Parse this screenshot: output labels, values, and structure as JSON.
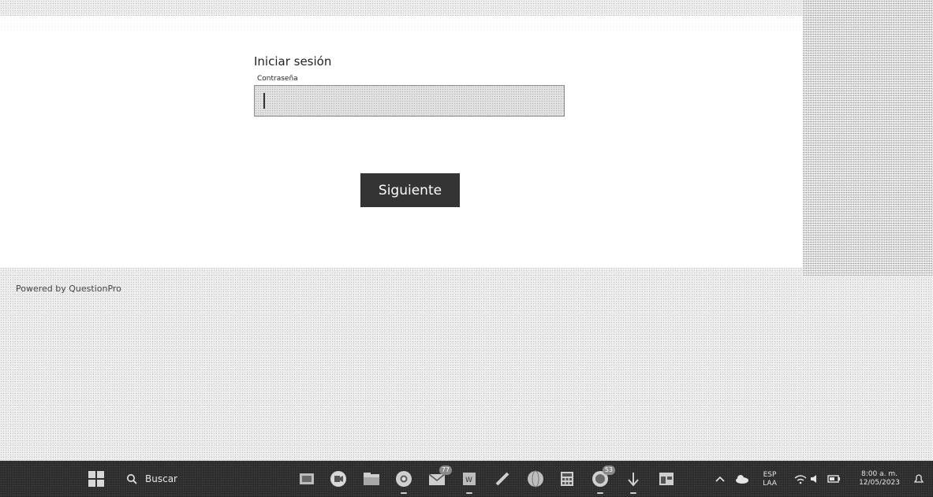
{
  "login": {
    "title": "Iniciar sesión",
    "password_label": "Contraseña",
    "password_value": "",
    "next_label": "Siguiente"
  },
  "footer": {
    "powered_by": "Powered by QuestionPro"
  },
  "taskbar": {
    "search_label": "Buscar",
    "apps": [
      {
        "name": "task-view-icon"
      },
      {
        "name": "video-call-icon"
      },
      {
        "name": "file-explorer-icon"
      },
      {
        "name": "chrome-icon"
      },
      {
        "name": "mail-icon",
        "badge": "77"
      },
      {
        "name": "word-icon"
      },
      {
        "name": "pen-icon"
      },
      {
        "name": "globe-icon"
      },
      {
        "name": "calculator-icon"
      },
      {
        "name": "whatsapp-icon",
        "badge": "53"
      },
      {
        "name": "acrobat-icon"
      },
      {
        "name": "app-window-icon"
      }
    ],
    "language": {
      "line1": "ESP",
      "line2": "LAA"
    },
    "clock": {
      "time": "8:00 a. m.",
      "date": "12/05/2023"
    }
  },
  "colors": {
    "button_bg": "#343434",
    "taskbar_bg": "#2d2d2d",
    "card_bg": "#ffffff"
  }
}
